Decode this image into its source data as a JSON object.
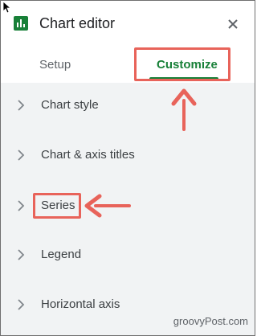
{
  "header": {
    "title": "Chart editor",
    "app_icon": "chart-icon",
    "close_icon": "close-icon"
  },
  "tabs": [
    {
      "label": "Setup",
      "selected": false
    },
    {
      "label": "Customize",
      "selected": true
    }
  ],
  "sections": [
    {
      "label": "Chart style"
    },
    {
      "label": "Chart & axis titles"
    },
    {
      "label": "Series"
    },
    {
      "label": "Legend"
    },
    {
      "label": "Horizontal axis"
    }
  ],
  "annotations": {
    "highlight_color": "#e8635a",
    "highlighted_items": [
      "Customize",
      "Series"
    ]
  },
  "watermark": "groovyPost.com",
  "colors": {
    "accent_green": "#188038",
    "list_background": "#f1f3f4",
    "text": "#3c4043"
  }
}
